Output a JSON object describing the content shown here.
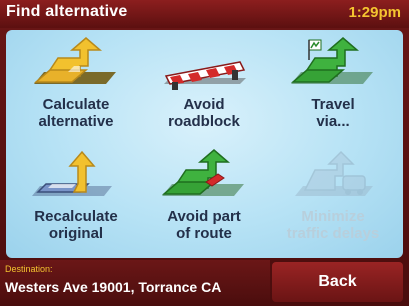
{
  "header": {
    "title": "Find alternative",
    "time": "1:29pm"
  },
  "menu": {
    "items": [
      {
        "label": "Calculate\nalternative",
        "icon": "calculate-alternative-icon",
        "enabled": true
      },
      {
        "label": "Avoid\nroadblock",
        "icon": "roadblock-icon",
        "enabled": true
      },
      {
        "label": "Travel\nvia...",
        "icon": "travel-via-icon",
        "enabled": true
      },
      {
        "label": "Recalculate\noriginal",
        "icon": "recalculate-original-icon",
        "enabled": true
      },
      {
        "label": "Avoid part\nof route",
        "icon": "avoid-part-of-route-icon",
        "enabled": true
      },
      {
        "label": "Minimize\ntraffic delays",
        "icon": "minimize-traffic-delays-icon",
        "enabled": false
      }
    ]
  },
  "footer": {
    "destination_label": "Destination:",
    "destination_value": "Westers Ave 19001, Torrance CA",
    "back_label": "Back"
  },
  "colors": {
    "accent": "#f4c430",
    "bar": "#6a1616",
    "panel": "#c4e8f7",
    "label": "#23304a",
    "disabled_label": "#b8cfdc"
  }
}
